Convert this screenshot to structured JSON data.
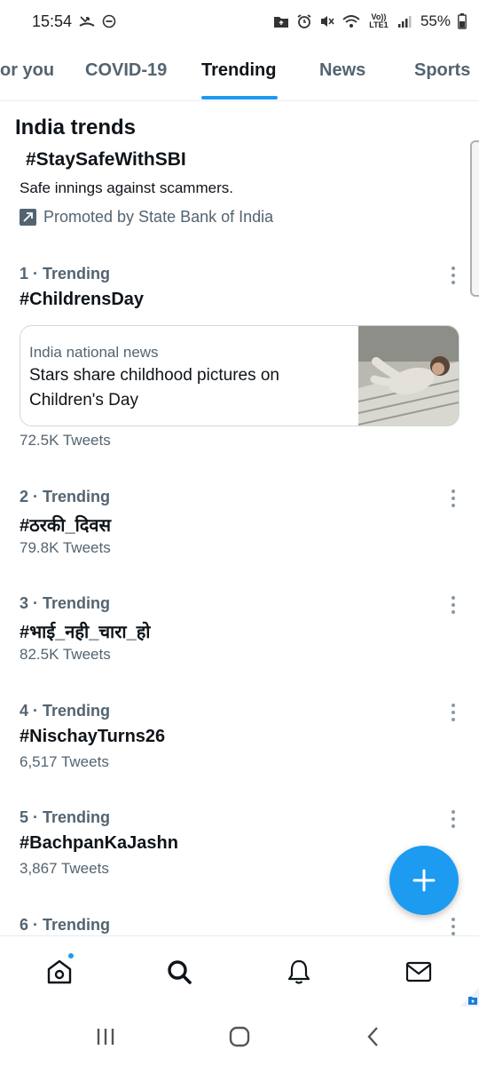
{
  "status_bar": {
    "time": "15:54",
    "battery": "55%",
    "network": "Vo)) LTE1"
  },
  "tabs": [
    {
      "label": "or you",
      "active": false
    },
    {
      "label": "COVID-19",
      "active": false
    },
    {
      "label": "Trending",
      "active": true
    },
    {
      "label": "News",
      "active": false
    },
    {
      "label": "Sports",
      "active": false
    }
  ],
  "section_title": "India trends",
  "promoted": {
    "hashtag": "#StaySafeWithSBI",
    "description": "Safe innings against scammers.",
    "promoted_by": "Promoted by State Bank of India"
  },
  "trends": [
    {
      "meta": "1 · Trending",
      "name": "#ChildrensDay",
      "count": "72.5K Tweets"
    },
    {
      "meta": "2 · Trending",
      "name": "#ठरकी_दिवस",
      "count": "79.8K Tweets"
    },
    {
      "meta": "3 · Trending",
      "name": "#भाई_नही_चारा_हो",
      "count": "82.5K Tweets"
    },
    {
      "meta": "4 · Trending",
      "name": "#NischayTurns26",
      "count": "6,517 Tweets"
    },
    {
      "meta": "5 · Trending",
      "name": "#BachpanKaJashn",
      "count": "3,867 Tweets"
    },
    {
      "meta": "6 · Trending",
      "name": "",
      "count": ""
    }
  ],
  "news_card": {
    "source": "India national news",
    "headline": "Stars share childhood pictures on Children's Day"
  },
  "colors": {
    "accent": "#1d9bf0",
    "text_primary": "#0f1419",
    "text_secondary": "#536471"
  },
  "icons": {
    "fab": "compose-plus-icon",
    "nav": [
      "home-icon",
      "search-icon",
      "bell-icon",
      "mail-icon"
    ],
    "system": [
      "recents-icon",
      "home-circle-icon",
      "back-icon"
    ]
  }
}
